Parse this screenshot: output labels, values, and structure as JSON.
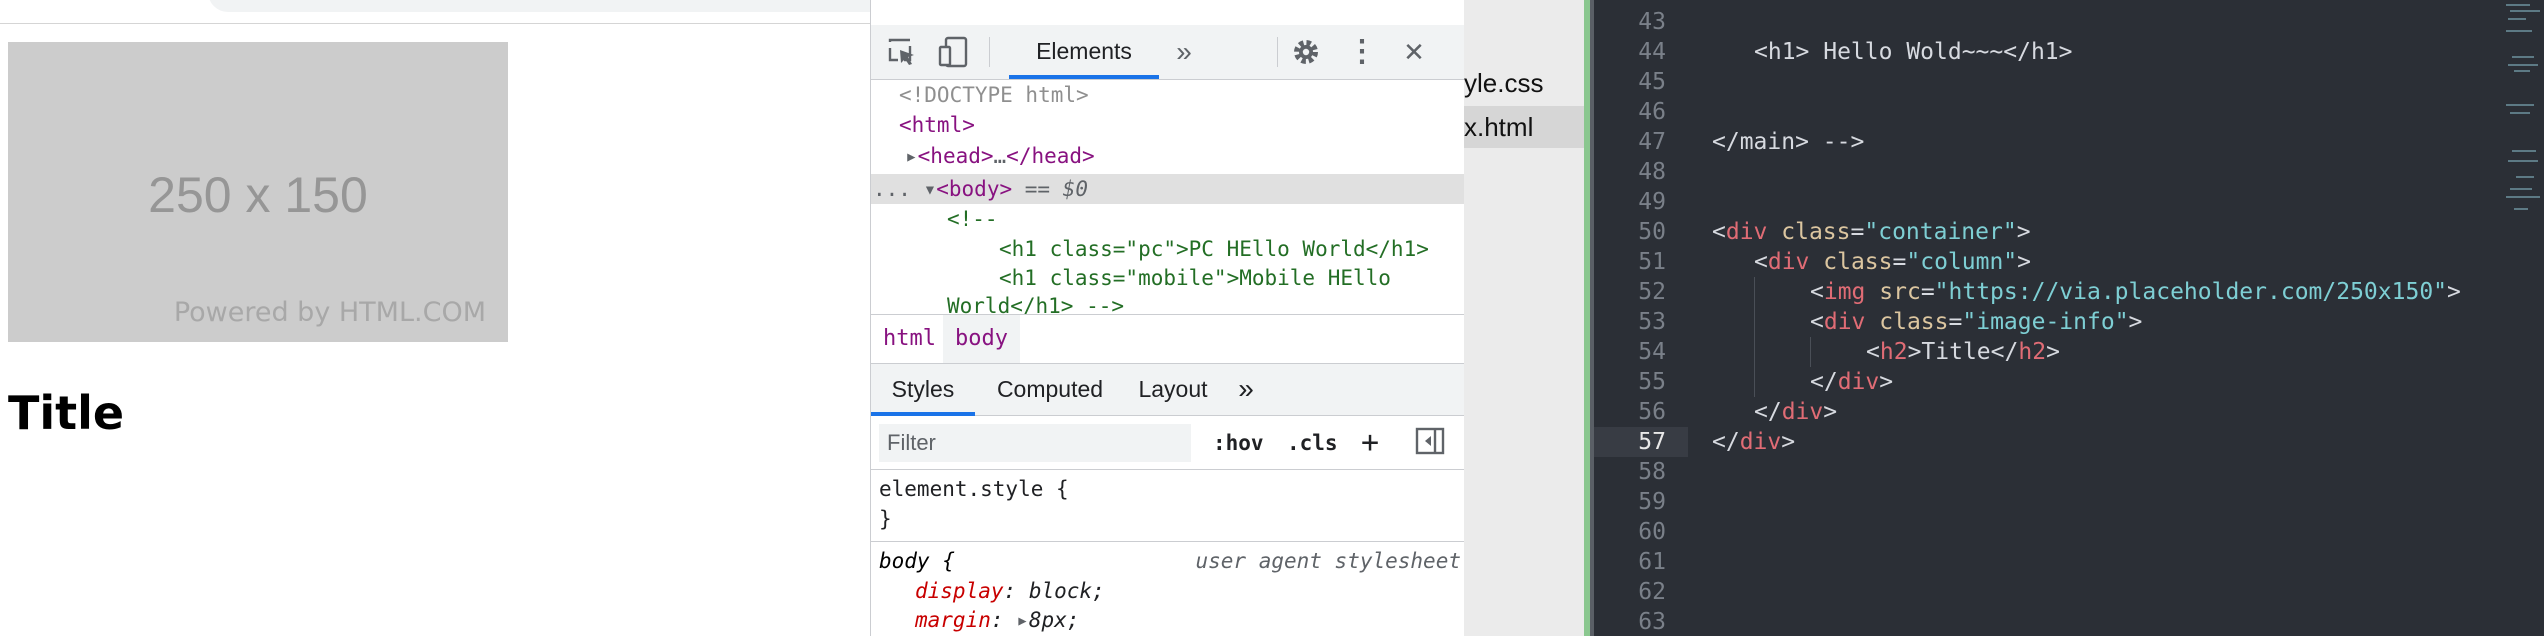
{
  "browser": {
    "image_size_text": "250 x 150",
    "image_powered_text": "Powered by HTML.COM",
    "page_title": "Title"
  },
  "devtools": {
    "toolbar": {
      "inspect_icon": "inspect-element-icon",
      "device_icon": "device-toolbar-icon",
      "elements_tab": "Elements",
      "more_tabs": "»",
      "settings_icon": "gear-icon",
      "menu_icon": "⋮",
      "close_icon": "✕"
    },
    "dom": {
      "doctype": "<!DOCTYPE html>",
      "html_open": "<html>",
      "head_tag": "<head>",
      "head_ellipsis": "…",
      "head_close": "</head>",
      "row_dots": "...",
      "body_tag": "<body>",
      "selected_marker": " == $0",
      "comment_open": "<!--",
      "comment_line1": "<h1 class=\"pc\">PC HEllo World</h1>",
      "comment_line2": "<h1 class=\"mobile\">Mobile HEllo",
      "comment_line3": "World</h1> -->"
    },
    "breadcrumb": [
      "html",
      "body"
    ],
    "styles_tabs": [
      "Styles",
      "Computed",
      "Layout",
      "»"
    ],
    "filter": {
      "placeholder": "Filter",
      "hov": ":hov",
      "cls": ".cls",
      "plus": "+"
    },
    "rules": {
      "element_style_open": "element.style {",
      "element_style_close": "}",
      "body_selector": "body {",
      "body_origin": "user agent stylesheet",
      "props": [
        {
          "name": "display",
          "value": "block;"
        },
        {
          "name": "margin",
          "value": "8px;"
        }
      ]
    }
  },
  "files": {
    "items": [
      {
        "label": "yle.css",
        "selected": false
      },
      {
        "label": "x.html",
        "selected": true
      }
    ]
  },
  "editor": {
    "line_numbers": [
      "43",
      "44",
      "45",
      "46",
      "47",
      "48",
      "49",
      "50",
      "51",
      "52",
      "53",
      "54",
      "55",
      "56",
      "57",
      "58",
      "59",
      "60",
      "61",
      "62",
      "63"
    ],
    "current_line": "57",
    "lines": {
      "l44": "<h1> Hello Wold~~~</h1>",
      "l47": "</main> -->",
      "l50_tag": "div",
      "l50_attr": "class",
      "l50_val": "\"container\"",
      "l51_tag": "div",
      "l51_attr": "class",
      "l51_val": "\"column\"",
      "l52_tag": "img",
      "l52_attr": "src",
      "l52_val": "\"https://via.placeholder.com/250x150\"",
      "l53_tag": "div",
      "l53_attr": "class",
      "l53_val": "\"image-info\"",
      "l54_tag": "h2",
      "l54_text": "Title",
      "l55": "div",
      "l56": "div",
      "l57": "div"
    }
  }
}
